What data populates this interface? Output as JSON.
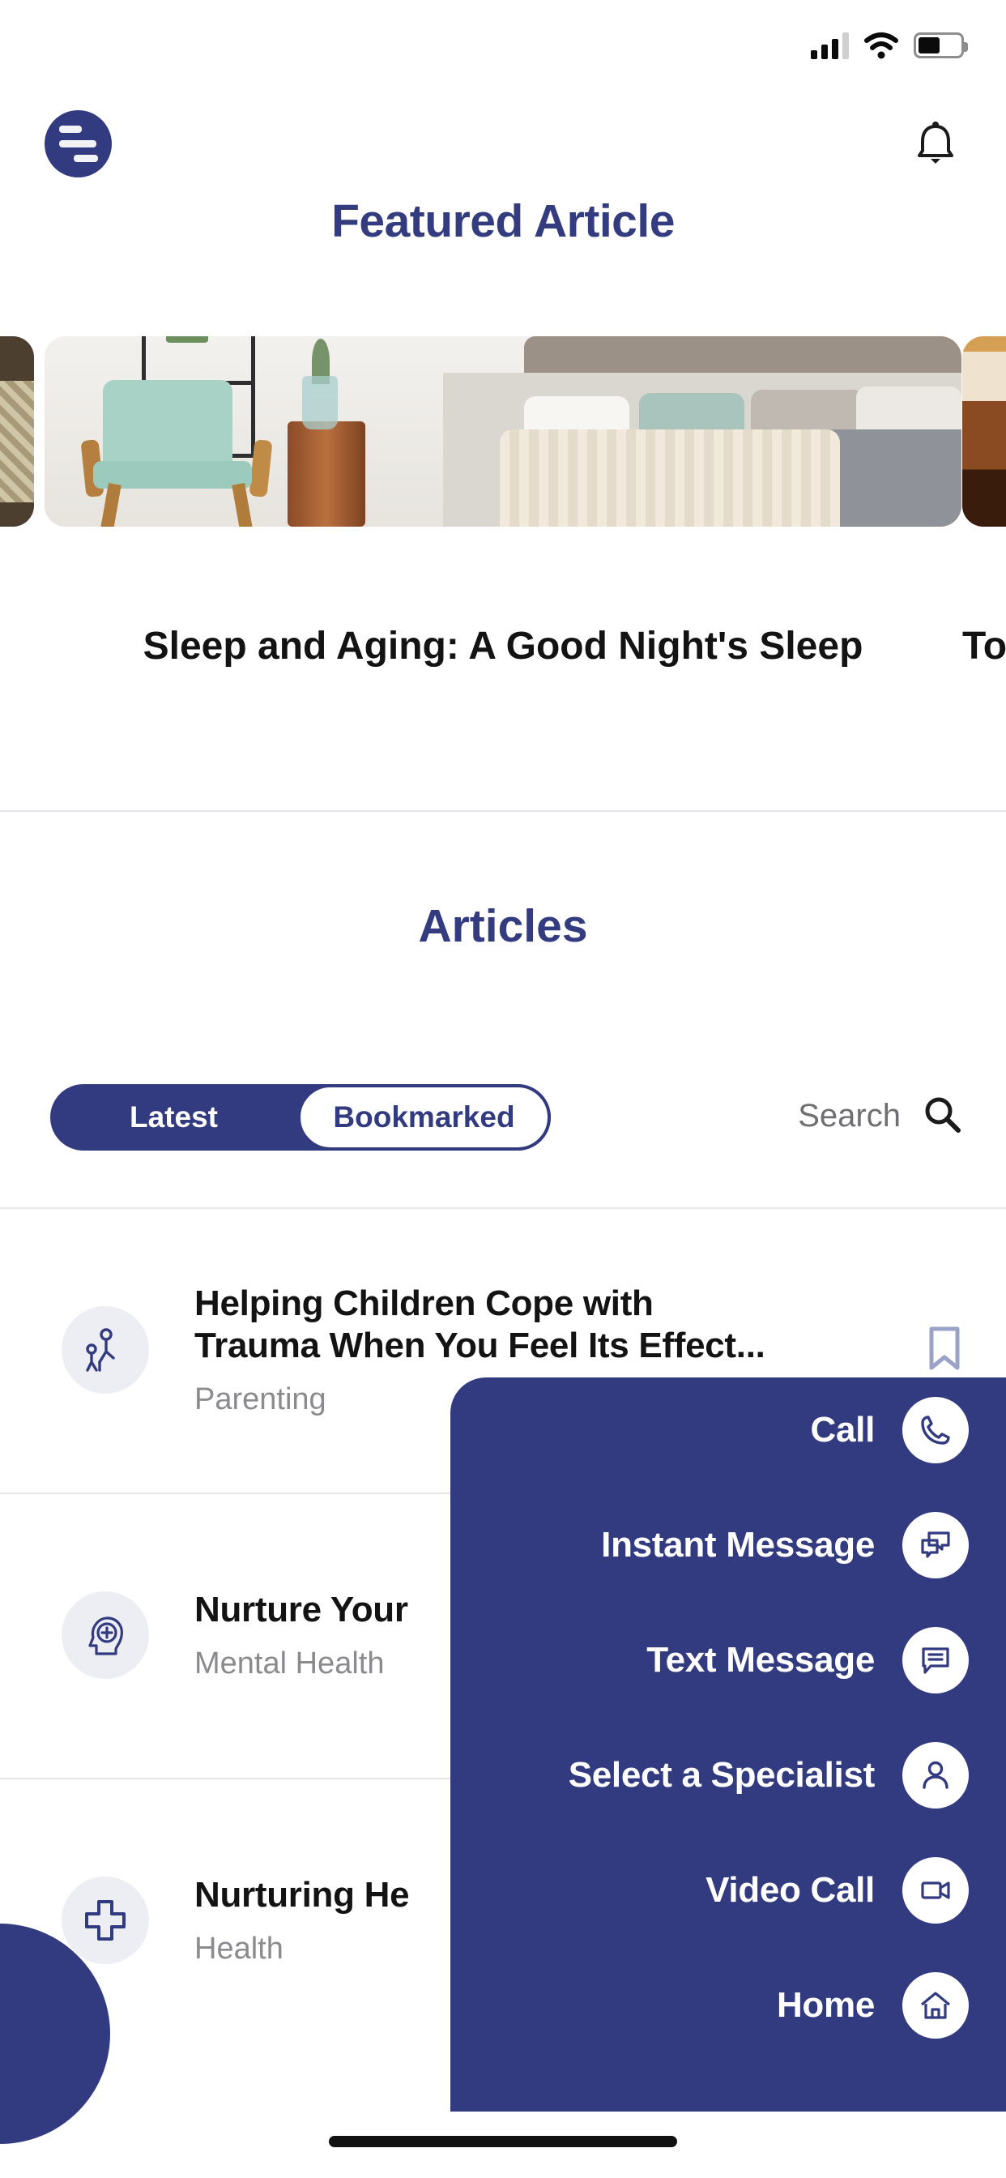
{
  "theme": {
    "navy": "#333b80",
    "navy_text": "#343c80",
    "gray_text": "#8a8a8f",
    "icon_bg": "#eceef4"
  },
  "status_bar": {
    "signal_icon": "cellular-signal-icon",
    "wifi_icon": "wifi-icon",
    "battery_icon": "battery-icon",
    "battery_level": "52"
  },
  "app_bar": {
    "menu_icon": "hamburger-menu-icon",
    "notification_icon": "bell-icon"
  },
  "featured": {
    "heading": "Featured Article",
    "cards": [
      {
        "caption": "",
        "image": "woman-on-patterned-sofa"
      },
      {
        "caption": "Sleep and Aging: A Good Night's Sleep",
        "image": "bedroom-with-mint-chair"
      },
      {
        "caption": "To",
        "image": "hot-coffee-cup"
      }
    ]
  },
  "articles": {
    "heading": "Articles",
    "tabs": [
      {
        "label": "Latest",
        "active": true
      },
      {
        "label": "Bookmarked",
        "active": false
      }
    ],
    "search": {
      "label": "Search",
      "icon": "search-icon"
    },
    "items": [
      {
        "title_line1": "Helping Children Cope with",
        "title_line2": "Trauma When You Feel Its Effect...",
        "category": "Parenting",
        "icon": "parent-and-child-icon",
        "bookmark_icon": "bookmark-icon"
      },
      {
        "title_line1": "Nurture Your",
        "title_line2": "",
        "category": "Mental Health",
        "icon": "head-with-medical-cross-icon",
        "bookmark_icon": "bookmark-icon"
      },
      {
        "title_line1": "Nurturing He",
        "title_line2": "",
        "category": "Health",
        "icon": "medical-cross-icon",
        "bookmark_icon": "bookmark-icon"
      }
    ]
  },
  "overlay_menu": {
    "close_icon": "close-icon",
    "items": [
      {
        "label": "Call",
        "icon": "phone-icon"
      },
      {
        "label": "Instant Message",
        "icon": "chat-bubbles-icon"
      },
      {
        "label": "Text Message",
        "icon": "message-bubble-icon"
      },
      {
        "label": "Select a Specialist",
        "icon": "person-icon"
      },
      {
        "label": "Video Call",
        "icon": "video-camera-icon"
      },
      {
        "label": "Home",
        "icon": "home-icon"
      }
    ]
  }
}
